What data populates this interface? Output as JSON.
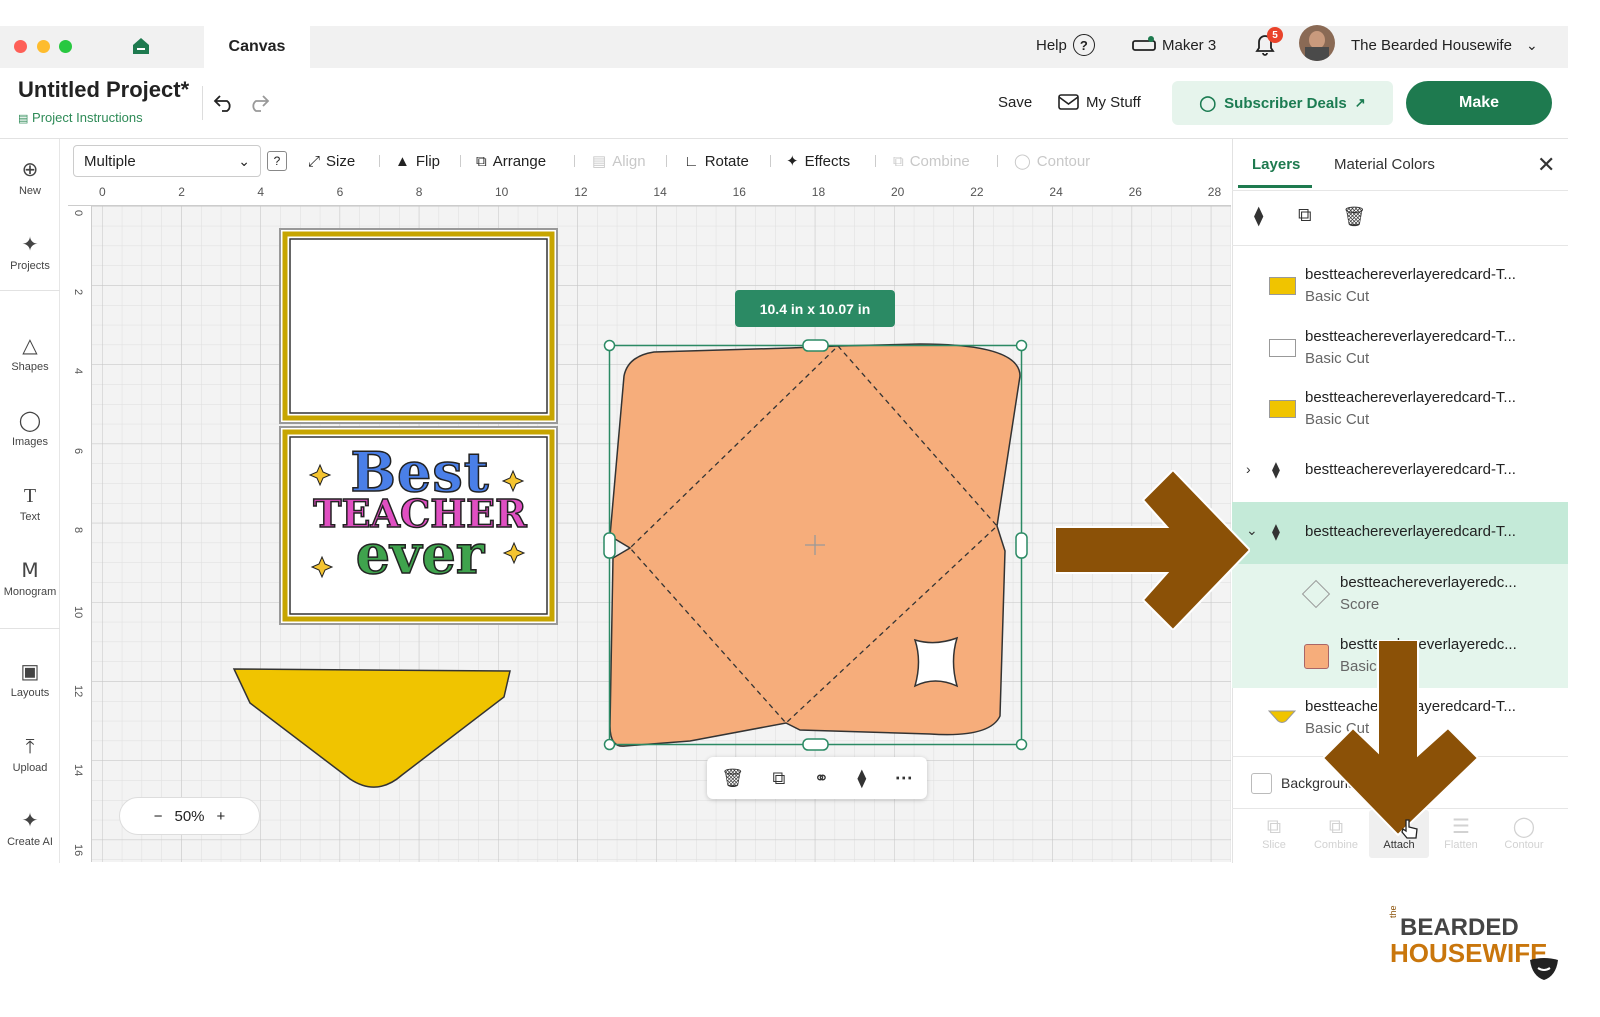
{
  "window": {
    "tab": "Canvas",
    "help": "Help",
    "machine": "Maker 3",
    "notification_count": "5",
    "user_name": "The Bearded Housewife"
  },
  "header": {
    "project_title": "Untitled Project*",
    "project_instructions": "Project Instructions",
    "save": "Save",
    "my_stuff": "My Stuff",
    "subscriber_deals": "Subscriber Deals",
    "make": "Make"
  },
  "sidebar": {
    "items": [
      {
        "label": "New",
        "icon": "plus-circle-icon"
      },
      {
        "label": "Projects",
        "icon": "projects-icon"
      },
      {
        "label": "Shapes",
        "icon": "shapes-icon"
      },
      {
        "label": "Images",
        "icon": "lightbulb-icon"
      },
      {
        "label": "Text",
        "icon": "text-icon"
      },
      {
        "label": "Monogram",
        "icon": "monogram-icon"
      },
      {
        "label": "Layouts",
        "icon": "shirt-icon"
      },
      {
        "label": "Upload",
        "icon": "upload-icon"
      },
      {
        "label": "Create AI",
        "icon": "sparkle-icon"
      }
    ]
  },
  "toolbar": {
    "select_value": "Multiple",
    "help": "?",
    "size": "Size",
    "flip": "Flip",
    "arrange": "Arrange",
    "align": "Align",
    "rotate": "Rotate",
    "effects": "Effects",
    "combine": "Combine",
    "contour": "Contour"
  },
  "rulers": {
    "top": [
      "0",
      "2",
      "4",
      "6",
      "8",
      "10",
      "12",
      "14",
      "16",
      "18",
      "20",
      "22",
      "24",
      "26",
      "28"
    ],
    "left": [
      "0",
      "2",
      "4",
      "6",
      "8",
      "10",
      "12",
      "14",
      "16"
    ]
  },
  "canvas": {
    "size_badge": "10.4  in x 10.07  in",
    "zoom": "50%",
    "zoom_minus": "−",
    "zoom_plus": "+",
    "card_text": {
      "line1": "Best",
      "line2": "TEACHER",
      "line3": "ever"
    }
  },
  "panel": {
    "tab_layers": "Layers",
    "tab_material": "Material Colors",
    "layers": [
      {
        "name": "bestteachereverlayeredcard-T...",
        "op": "Basic Cut",
        "color": "#f0c400"
      },
      {
        "name": "bestteachereverlayeredcard-T...",
        "op": "Basic Cut",
        "color": "#ffffff"
      },
      {
        "name": "bestteachereverlayeredcard-T...",
        "op": "Basic Cut",
        "color": "#f0c400"
      },
      {
        "name": "bestteachereverlayeredcard-T...",
        "op": ""
      },
      {
        "name": "bestteachereverlayeredcard-T...",
        "op": ""
      },
      {
        "name": "bestteachereverlayeredc...",
        "op": "Score"
      },
      {
        "name": "bestteachereverlayeredc...",
        "op": "Basic",
        "color": "#f6ad7b"
      },
      {
        "name": "bestteachereverlayeredcard-T...",
        "op": "Basic Cut",
        "color": "#f0c400"
      }
    ],
    "background_label": "Background",
    "actions": [
      "Slice",
      "Combine",
      "Attach",
      "Flatten",
      "Contour"
    ]
  },
  "watermark": {
    "line1": "BEARDED",
    "line2": "HOUSEWIFE",
    "prefix": "the"
  },
  "colors": {
    "brand_green": "#1e7a4f",
    "envelope": "#f6ad7b",
    "yellow": "#f0c400",
    "arrow": "#8b5107",
    "selection": "#2b8a64"
  }
}
